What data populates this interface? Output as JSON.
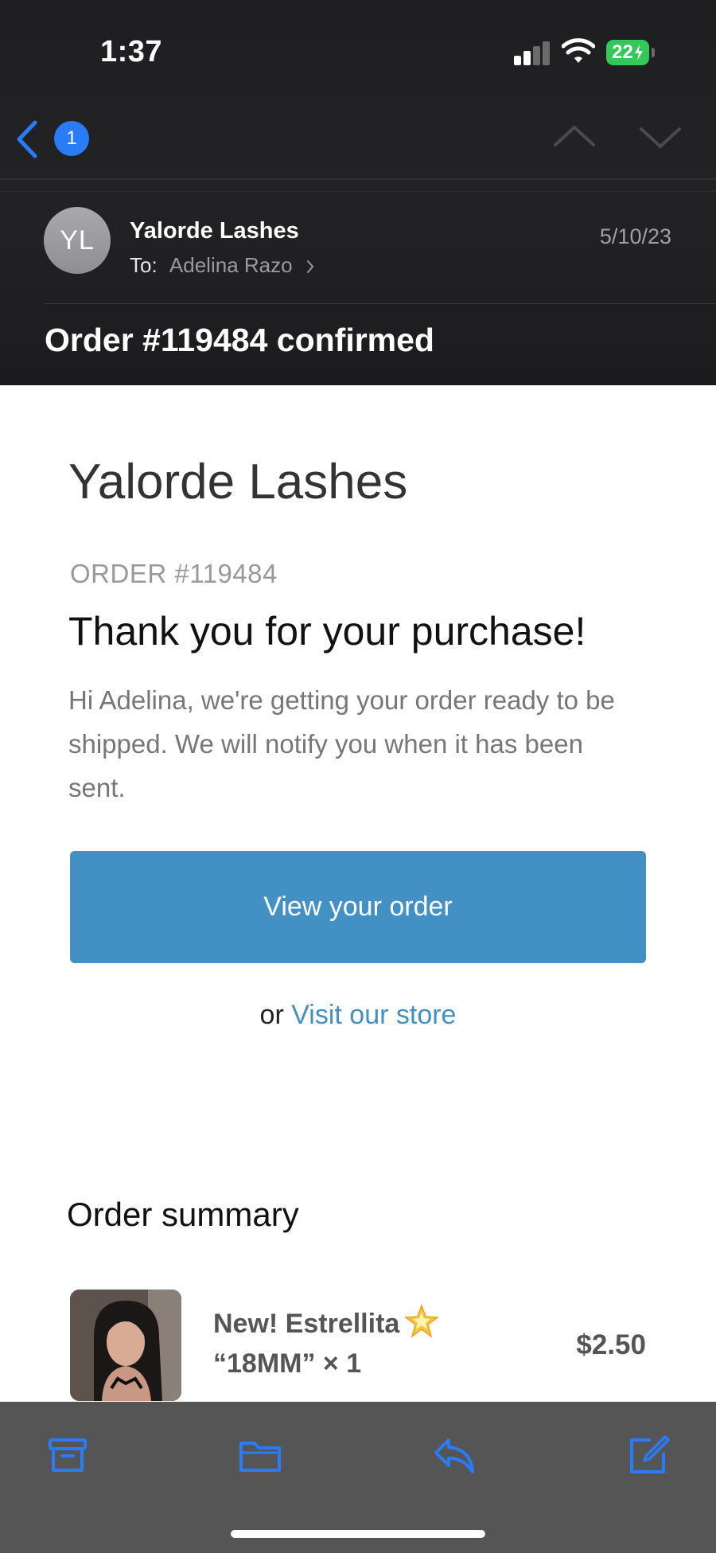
{
  "status_bar": {
    "time": "1:37",
    "battery": "22"
  },
  "nav": {
    "unread_count": "1"
  },
  "email": {
    "avatar_initials": "YL",
    "sender": "Yalorde Lashes",
    "to_label": "To:",
    "recipient": "Adelina Razo",
    "date": "5/10/23",
    "subject": "Order #119484 confirmed"
  },
  "body": {
    "store_name": "Yalorde Lashes",
    "order_label": "ORDER #119484",
    "thanks": "Thank you for your purchase!",
    "message": "Hi Adelina, we're getting your order ready to be shipped. We will notify you when it has been sent.",
    "view_order_button": "View your order",
    "or_text": "or",
    "visit_store_link": "Visit our store",
    "summary_title": "Order summary",
    "items": [
      {
        "name": "New! Estrellita",
        "variant": "“18MM” × 1",
        "price": "$2.50"
      }
    ]
  },
  "colors": {
    "accent": "#4290c4",
    "ios_blue": "#2a7bf6",
    "battery_green": "#34c759"
  },
  "icons": {
    "toolbar": [
      "archive-icon",
      "folder-icon",
      "reply-icon",
      "compose-icon"
    ]
  }
}
